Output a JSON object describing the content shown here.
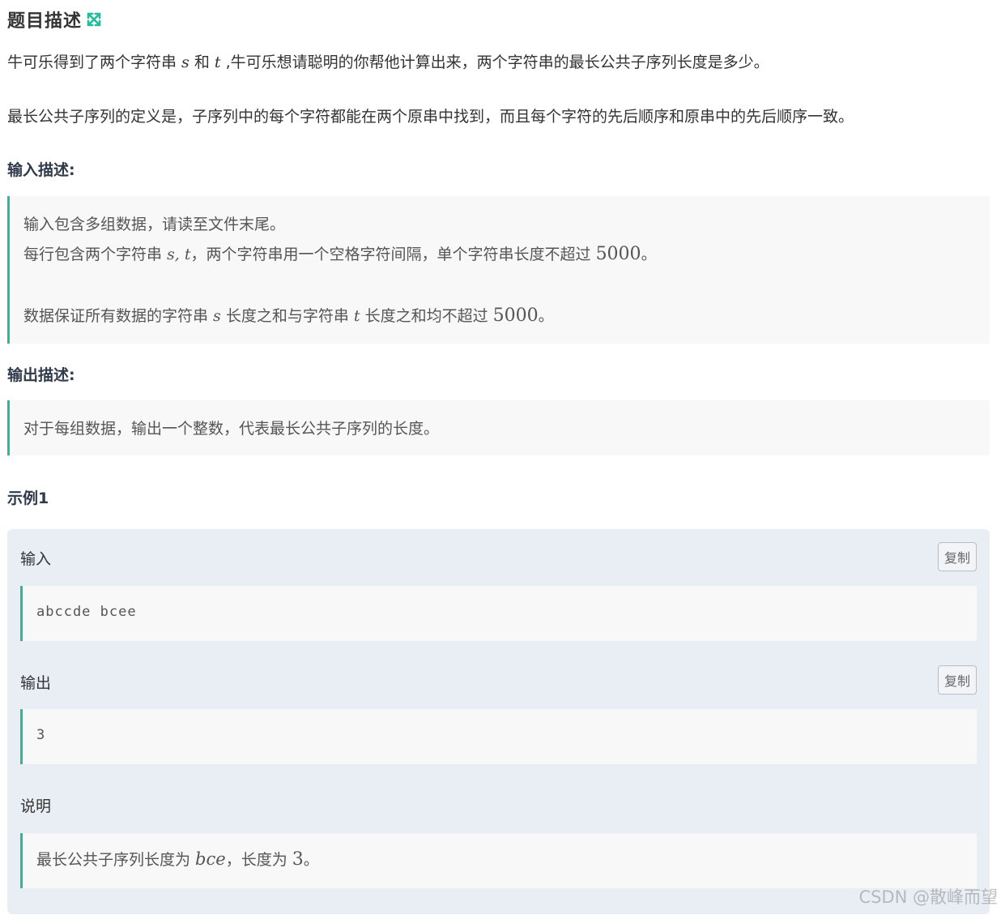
{
  "header": {
    "title": "题目描述",
    "expand_icon": "expand-arrows-icon",
    "accent_color": "#25bb9b"
  },
  "description": {
    "p1_a": "牛可乐得到了两个字符串 ",
    "p1_s": "s",
    "p1_b": " 和 ",
    "p1_t": "t",
    "p1_c": " ,牛可乐想请聪明的你帮他计算出来，两个字符串的最长公共子序列长度是多少。",
    "p2": "最长公共子序列的定义是，子序列中的每个字符都能在两个原串中找到，而且每个字符的先后顺序和原串中的先后顺序一致。"
  },
  "input_section": {
    "heading": "输入描述:",
    "line1": "输入包含多组数据，请读至文件末尾。",
    "line2_a": "每行包含两个字符串 ",
    "line2_st": "s, t",
    "line2_b": "，两个字符串用一个空格字符间隔，单个字符串长度不超过 ",
    "line2_num": "5000",
    "line2_c": "。",
    "line3_a": "数据保证所有数据的字符串 ",
    "line3_s": "s",
    "line3_b": " 长度之和与字符串 ",
    "line3_t": "t",
    "line3_c": " 长度之和均不超过 ",
    "line3_num": "5000",
    "line3_d": "。"
  },
  "output_section": {
    "heading": "输出描述:",
    "line1": "对于每组数据，输出一个整数，代表最长公共子序列的长度。"
  },
  "example": {
    "heading": "示例1",
    "input_label": "输入",
    "input_value": "abccde bcee",
    "output_label": "输出",
    "output_value": "3",
    "note_label": "说明",
    "note_a": "最长公共子序列长度为 ",
    "note_math": "bce",
    "note_b": "，长度为 ",
    "note_num": "3",
    "note_c": "。",
    "copy_label": "复制"
  },
  "watermark": "CSDN @散峰而望"
}
